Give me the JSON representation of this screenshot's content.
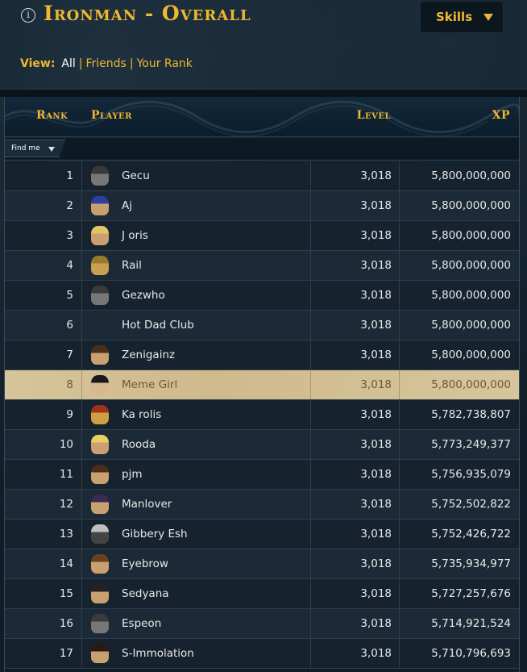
{
  "header": {
    "info_icon": "i",
    "title": "Ironman - Overall",
    "skills_button": "Skills"
  },
  "view": {
    "label": "View:",
    "options": [
      "All",
      "Friends",
      "Your Rank"
    ],
    "separator": "|"
  },
  "table": {
    "columns": {
      "rank": "Rank",
      "player": "Player",
      "level": "Level",
      "xp": "XP"
    },
    "find_me": "Find me",
    "rows": [
      {
        "rank": "1",
        "player": "Gecu",
        "level": "3,018",
        "xp": "5,800,000,000",
        "avatar": "helmet-avatar-icon"
      },
      {
        "rank": "2",
        "player": "Aj",
        "level": "3,018",
        "xp": "5,800,000,000",
        "avatar": "blue-hair-avatar-icon"
      },
      {
        "rank": "3",
        "player": "J oris",
        "level": "3,018",
        "xp": "5,800,000,000",
        "avatar": "blonde-avatar-icon"
      },
      {
        "rank": "4",
        "player": "Rail",
        "level": "3,018",
        "xp": "5,800,000,000",
        "avatar": "gold-mask-avatar-icon"
      },
      {
        "rank": "5",
        "player": "Gezwho",
        "level": "3,018",
        "xp": "5,800,000,000",
        "avatar": "helmet-avatar-icon"
      },
      {
        "rank": "6",
        "player": "Hot Dad Club",
        "level": "3,018",
        "xp": "5,800,000,000",
        "avatar": ""
      },
      {
        "rank": "7",
        "player": "Zenigainz",
        "level": "3,018",
        "xp": "5,800,000,000",
        "avatar": "brown-hair-avatar-icon"
      },
      {
        "rank": "8",
        "player": "Meme Girl",
        "level": "3,018",
        "xp": "5,800,000,000",
        "avatar": "graduation-cap-avatar-icon",
        "highlight": true
      },
      {
        "rank": "9",
        "player": "Ka rolis",
        "level": "3,018",
        "xp": "5,782,738,807",
        "avatar": "red-helm-avatar-icon"
      },
      {
        "rank": "10",
        "player": "Rooda",
        "level": "3,018",
        "xp": "5,773,249,377",
        "avatar": "yellow-crown-avatar-icon"
      },
      {
        "rank": "11",
        "player": "pjm",
        "level": "3,018",
        "xp": "5,756,935,079",
        "avatar": "brown-hair-avatar-icon"
      },
      {
        "rank": "12",
        "player": "Manlover",
        "level": "3,018",
        "xp": "5,752,502,822",
        "avatar": "purple-cap-avatar-icon"
      },
      {
        "rank": "13",
        "player": "Gibbery Esh",
        "level": "3,018",
        "xp": "5,752,426,722",
        "avatar": "silver-mask-avatar-icon"
      },
      {
        "rank": "14",
        "player": "Eyebrow",
        "level": "3,018",
        "xp": "5,735,934,977",
        "avatar": "long-hair-avatar-icon"
      },
      {
        "rank": "15",
        "player": "Sedyana",
        "level": "3,018",
        "xp": "5,727,257,676",
        "avatar": "elf-avatar-icon"
      },
      {
        "rank": "16",
        "player": "Espeon",
        "level": "3,018",
        "xp": "5,714,921,524",
        "avatar": "helmet-avatar-icon"
      },
      {
        "rank": "17",
        "player": "S-Immolation",
        "level": "3,018",
        "xp": "5,710,796,693",
        "avatar": "dark-hair-avatar-icon"
      }
    ]
  },
  "colors": {
    "accent": "#f0b830",
    "background": "#0f1d28",
    "highlight_row": "#d7c49a"
  }
}
